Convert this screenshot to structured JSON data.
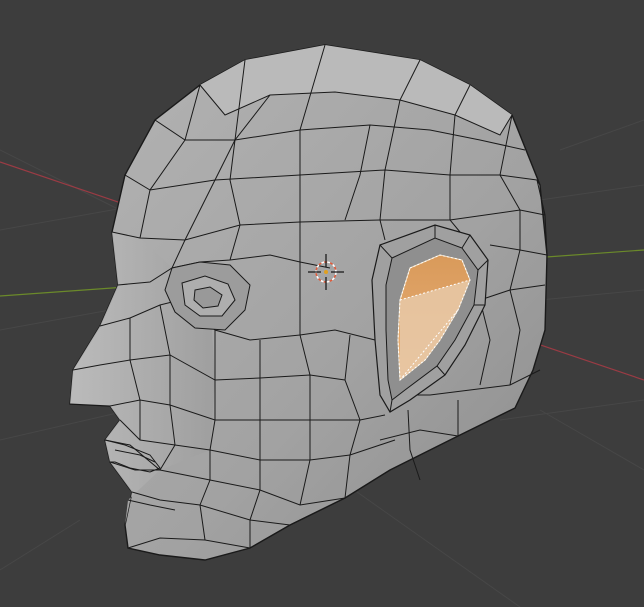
{
  "viewport": {
    "mode": "edit-mode",
    "object": "low-poly-head-mesh",
    "selection": "ear-inner-faces"
  },
  "colors": {
    "background": "#3d3d3d",
    "grid_line": "#474747",
    "axis_x": "#9a3b44",
    "axis_y": "#6b8a2a",
    "mesh_fill": "#a8a8a8",
    "mesh_edge": "#1a1a1a",
    "selected_face": "#e0a060",
    "selected_edge": "#ffffff",
    "cursor_ring": "#e05a3a"
  },
  "icons": {
    "cursor": "3d-cursor-icon"
  }
}
